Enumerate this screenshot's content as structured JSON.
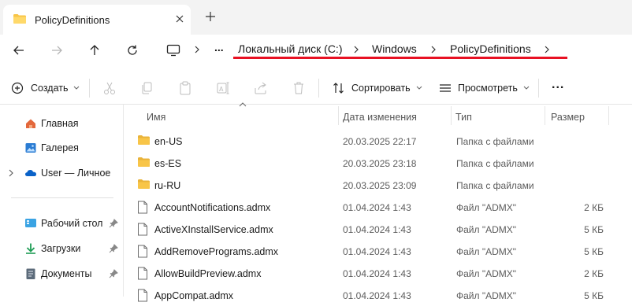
{
  "tab": {
    "title": "PolicyDefinitions"
  },
  "breadcrumb": {
    "overflow": "...",
    "items": [
      "Локальный диск (C:)",
      "Windows",
      "PolicyDefinitions"
    ]
  },
  "toolbar": {
    "create_label": "Создать",
    "sort_label": "Сортировать",
    "view_label": "Просмотреть",
    "more_label": "..."
  },
  "sidebar": {
    "items": [
      {
        "label": "Главная",
        "icon": "home-icon"
      },
      {
        "label": "Галерея",
        "icon": "gallery-icon"
      },
      {
        "label": "User — Личное",
        "icon": "onedrive-icon"
      },
      {
        "label": "Рабочий стол",
        "icon": "desktop-icon"
      },
      {
        "label": "Загрузки",
        "icon": "downloads-icon"
      },
      {
        "label": "Документы",
        "icon": "documents-icon"
      }
    ]
  },
  "columns": {
    "name": "Имя",
    "date": "Дата изменения",
    "type": "Тип",
    "size": "Размер"
  },
  "files": [
    {
      "name": "en-US",
      "date": "20.03.2025 22:17",
      "type": "Папка с файлами",
      "size": "",
      "kind": "folder"
    },
    {
      "name": "es-ES",
      "date": "20.03.2025 23:18",
      "type": "Папка с файлами",
      "size": "",
      "kind": "folder"
    },
    {
      "name": "ru-RU",
      "date": "20.03.2025 23:09",
      "type": "Папка с файлами",
      "size": "",
      "kind": "folder"
    },
    {
      "name": "AccountNotifications.admx",
      "date": "01.04.2024 1:43",
      "type": "Файл \"ADMX\"",
      "size": "2 КБ",
      "kind": "file"
    },
    {
      "name": "ActiveXInstallService.admx",
      "date": "01.04.2024 1:43",
      "type": "Файл \"ADMX\"",
      "size": "5 КБ",
      "kind": "file"
    },
    {
      "name": "AddRemovePrograms.admx",
      "date": "01.04.2024 1:43",
      "type": "Файл \"ADMX\"",
      "size": "5 КБ",
      "kind": "file"
    },
    {
      "name": "AllowBuildPreview.admx",
      "date": "01.04.2024 1:43",
      "type": "Файл \"ADMX\"",
      "size": "2 КБ",
      "kind": "file"
    },
    {
      "name": "AppCompat.admx",
      "date": "01.04.2024 1:43",
      "type": "Файл \"ADMX\"",
      "size": "5 КБ",
      "kind": "file"
    }
  ],
  "colors": {
    "accent": "#0067c0",
    "folder": "#f8c548",
    "annotation": "#e81123"
  }
}
